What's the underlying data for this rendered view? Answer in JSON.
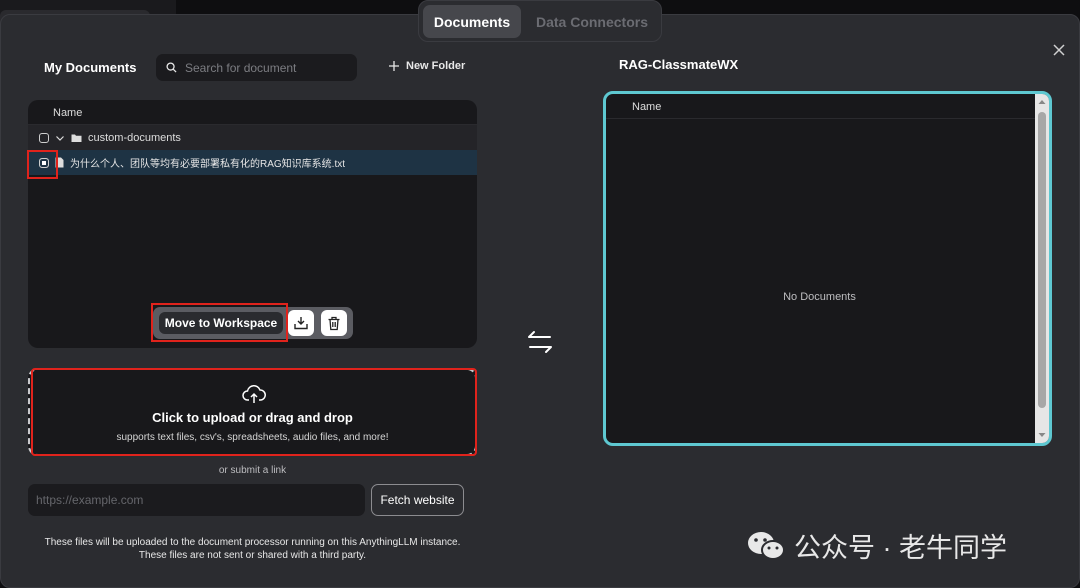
{
  "tabs": [
    {
      "label": "Documents",
      "active": true
    },
    {
      "label": "Data Connectors",
      "active": false
    }
  ],
  "my_documents": {
    "title": "My Documents",
    "search_placeholder": "Search for document",
    "new_folder_label": "New Folder",
    "column_name": "Name",
    "folder": {
      "name": "custom-documents",
      "checked": false
    },
    "files": [
      {
        "name": "为什么个人、团队等均有必要部署私有化的RAG知识库系统.txt",
        "checked": true
      }
    ],
    "move_to_workspace_label": "Move to Workspace"
  },
  "upload": {
    "title": "Click to upload or drag and drop",
    "subtitle": "supports text files, csv's, spreadsheets, audio files, and more!",
    "or_link": "or submit a link",
    "link_placeholder": "https://example.com",
    "fetch_label": "Fetch website",
    "footer_line1": "These files will be uploaded to the document processor running on this AnythingLLM instance.",
    "footer_line2": "These files are not sent or shared with a third party."
  },
  "workspace": {
    "title": "RAG-ClassmateWX",
    "column_name": "Name",
    "empty_text": "No Documents"
  },
  "watermark": {
    "text": "公众号 · 老牛同学"
  },
  "colors": {
    "accent": "#5ec8d1",
    "highlight": "#e0231c",
    "selected_row": "#1e3344"
  }
}
